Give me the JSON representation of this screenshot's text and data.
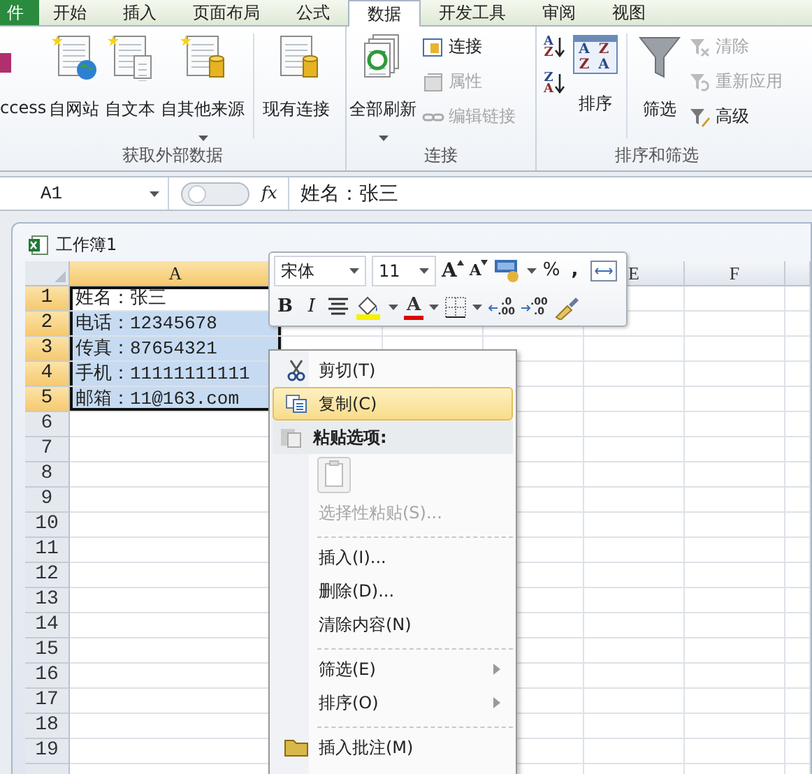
{
  "ribbon": {
    "tabs": [
      {
        "label": "件",
        "kind": "file",
        "selected": false
      },
      {
        "label": "开始",
        "kind": "tab",
        "selected": false
      },
      {
        "label": "插入",
        "kind": "tab",
        "selected": false
      },
      {
        "label": "页面布局",
        "kind": "tab",
        "selected": false
      },
      {
        "label": "公式",
        "kind": "tab",
        "selected": false
      },
      {
        "label": "数据",
        "kind": "tab",
        "selected": true
      },
      {
        "label": "开发工具",
        "kind": "tab",
        "selected": false
      },
      {
        "label": "审阅",
        "kind": "tab",
        "selected": false
      },
      {
        "label": "视图",
        "kind": "tab",
        "selected": false
      }
    ],
    "groups": [
      {
        "label": "获取外部数据",
        "large": [
          {
            "label": "ccess"
          },
          {
            "label": "自网站"
          },
          {
            "label": "自文本"
          },
          {
            "label": "自其他来源",
            "dropdown": true
          },
          {
            "label": "现有连接"
          }
        ]
      },
      {
        "label": "连接",
        "large": [
          {
            "label": "全部刷新",
            "dropdown": true
          }
        ],
        "small": [
          {
            "label": "连接",
            "disabled": false
          },
          {
            "label": "属性",
            "disabled": true
          },
          {
            "label": "编辑链接",
            "disabled": true
          }
        ]
      },
      {
        "label": "排序和筛选",
        "sort_asc": [
          "A",
          "Z"
        ],
        "sort_desc": [
          "Z",
          "A"
        ],
        "sort_grid": [
          "A",
          "Z",
          "Z",
          "A"
        ],
        "large": [
          {
            "label": "排序"
          },
          {
            "label": "筛选"
          }
        ],
        "small": [
          {
            "label": "清除",
            "disabled": true
          },
          {
            "label": "重新应用",
            "disabled": true
          },
          {
            "label": "高级",
            "disabled": false
          }
        ]
      }
    ]
  },
  "formula_bar": {
    "name_box": "A1",
    "fx": "fx",
    "value": "姓名：张三"
  },
  "workbook": {
    "title": "工作簿1",
    "columns": [
      {
        "label": "A",
        "selected": true
      },
      {
        "label": "E",
        "selected": false
      },
      {
        "label": "F",
        "selected": false
      }
    ],
    "rows": [
      {
        "number": "1",
        "selected": true,
        "active": true,
        "value": "姓名：张三"
      },
      {
        "number": "2",
        "selected": true,
        "active": false,
        "value": "电话：12345678"
      },
      {
        "number": "3",
        "selected": true,
        "active": false,
        "value": "传真：87654321"
      },
      {
        "number": "4",
        "selected": true,
        "active": false,
        "value": "手机：11111111111"
      },
      {
        "number": "5",
        "selected": true,
        "active": false,
        "value": "邮箱：11@163.com"
      },
      {
        "number": "6",
        "selected": false
      },
      {
        "number": "7",
        "selected": false
      },
      {
        "number": "8",
        "selected": false
      },
      {
        "number": "9",
        "selected": false
      },
      {
        "number": "10",
        "selected": false
      },
      {
        "number": "11",
        "selected": false
      },
      {
        "number": "12",
        "selected": false
      },
      {
        "number": "13",
        "selected": false
      },
      {
        "number": "14",
        "selected": false
      },
      {
        "number": "15",
        "selected": false
      },
      {
        "number": "16",
        "selected": false
      },
      {
        "number": "17",
        "selected": false
      },
      {
        "number": "18",
        "selected": false
      },
      {
        "number": "19",
        "selected": false
      }
    ]
  },
  "mini_toolbar": {
    "font": "宋体",
    "size": "11",
    "grow": "A",
    "shrink": "A",
    "percent": "%",
    "comma": ",",
    "bold": "B",
    "italic": "I",
    "font_color": "A",
    "increase_decimal": [
      ".0",
      ".00"
    ],
    "decrease_decimal": [
      ".00",
      ".0"
    ]
  },
  "context_menu": [
    {
      "kind": "command",
      "label": "剪切(T)",
      "selected": false,
      "disabled": false,
      "submenu": false
    },
    {
      "kind": "command",
      "label": "复制(C)",
      "selected": true,
      "disabled": false,
      "submenu": false
    },
    {
      "kind": "header",
      "label": "粘贴选项:"
    },
    {
      "kind": "paste-options"
    },
    {
      "kind": "command",
      "label": "选择性粘贴(S)...",
      "selected": false,
      "disabled": true,
      "submenu": false
    },
    {
      "kind": "separator"
    },
    {
      "kind": "command",
      "label": "插入(I)...",
      "selected": false,
      "disabled": false,
      "submenu": false
    },
    {
      "kind": "command",
      "label": "删除(D)...",
      "selected": false,
      "disabled": false,
      "submenu": false
    },
    {
      "kind": "command",
      "label": "清除内容(N)",
      "selected": false,
      "disabled": false,
      "submenu": false
    },
    {
      "kind": "separator"
    },
    {
      "kind": "command",
      "label": "筛选(E)",
      "selected": false,
      "disabled": false,
      "submenu": true
    },
    {
      "kind": "command",
      "label": "排序(O)",
      "selected": false,
      "disabled": false,
      "submenu": true
    },
    {
      "kind": "separator"
    },
    {
      "kind": "command",
      "label": "插入批注(M)",
      "selected": false,
      "disabled": false,
      "submenu": false
    }
  ]
}
